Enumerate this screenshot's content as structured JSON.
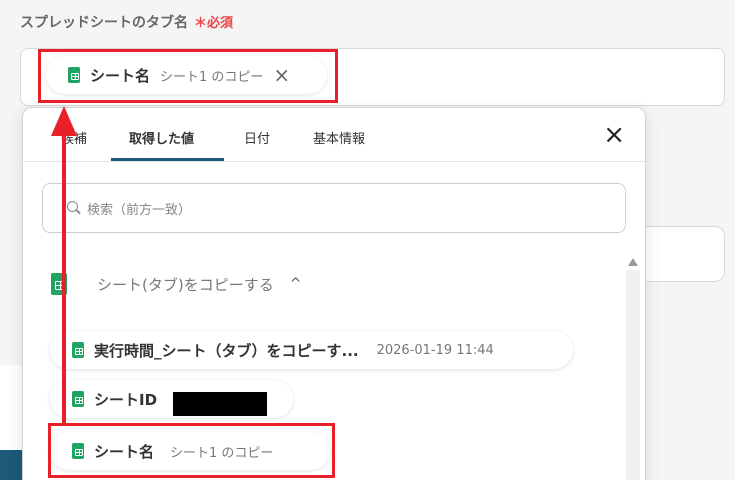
{
  "field": {
    "label": "スプレッドシートのタブ名",
    "required": "＊必須"
  },
  "selected_chip": {
    "name": "シート名",
    "value": "シート1 のコピー",
    "remove": "×"
  },
  "popup": {
    "tabs": [
      {
        "label": "候補",
        "active": false
      },
      {
        "label": "取得した値",
        "active": true
      },
      {
        "label": "日付",
        "active": false
      },
      {
        "label": "基本情報",
        "active": false
      }
    ],
    "close": "×",
    "search_placeholder": "検索（前方一致）",
    "section": {
      "label": "シート(タブ)をコピーする",
      "chevron": "^"
    },
    "items": [
      {
        "name": "実行時間_シート（タブ）をコピーす...",
        "value": "2026-01-19 11:44"
      },
      {
        "name": "シートID",
        "value": ""
      },
      {
        "name": "シート名",
        "value": "シート1 のコピー"
      }
    ]
  },
  "colors": {
    "accent": "#1e5a7a",
    "required": "#e8454a",
    "highlight": "#e8202a",
    "sheet_icon": "#1fa463"
  }
}
